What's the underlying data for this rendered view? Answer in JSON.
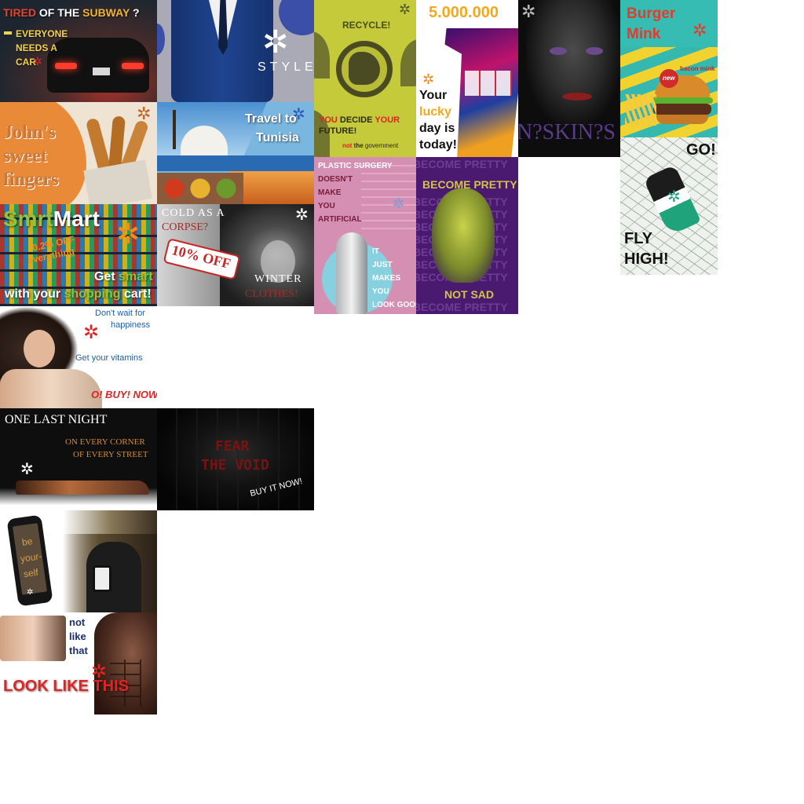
{
  "colors": {
    "accent_red": "#e02424",
    "accent_orange": "#f28c1a",
    "lime": "#c3c936",
    "pink": "#d58cb0",
    "purple": "#4a1a70"
  },
  "ads": {
    "subway": {
      "l1a": "TIRED",
      "l1b": "OF THE",
      "l1c": "SUBWAY",
      "l1d": "?",
      "l2": "EVERYONE",
      "l3": "NEEDS A",
      "l4": "CAR"
    },
    "style": {
      "brand": "STYLE."
    },
    "recycle": {
      "title": "RECYCLE!",
      "you": "YOU",
      "decide": "DECIDE",
      "your": "YOUR",
      "future": "FUTURE!",
      "not": "not",
      "the": "the",
      "gov": "government"
    },
    "lottery": {
      "amount": "5.000.000",
      "your": "Your",
      "lucky": "lucky",
      "day": "day is",
      "today": "today!"
    },
    "skin": {
      "text": "N?SKIN?S"
    },
    "burger": {
      "l1": "Burger",
      "l2": "Mink",
      "badge": "new",
      "sub": "bacon mink"
    },
    "johns": {
      "l1": "John's",
      "l2": "sweet",
      "l3": "fingers"
    },
    "tunisia": {
      "l1": "Travel to",
      "l2": "Tunisia"
    },
    "plastic": {
      "l1": "PLASTIC SURGERY",
      "l2": "DOESN'T",
      "l3": "MAKE",
      "l4": "YOU",
      "l5": "ARTIFICIAL",
      "l6": "IT",
      "l7": "JUST",
      "l8": "MAKES",
      "l9": "YOU",
      "l10": "LOOK GOOD"
    },
    "pretty": {
      "bg": "BECOME PRETTY",
      "title": "BECOME PRETTY",
      "bottom": "NOT SAD"
    },
    "shoe": {
      "go": "GO!",
      "l1": "FLY",
      "l2": "HIGH!"
    },
    "smrt": {
      "a": "Smrt",
      "b": "Mart",
      "promo1": "0.2% OFF",
      "promo2": "everything",
      "l1a": "Get",
      "l1b": "smart",
      "l2a": "with your",
      "l2b": "shopping",
      "l2c": "cart!"
    },
    "corpse": {
      "l1": "COLD AS A",
      "l2": "CORPSE?",
      "badge": "10% OFF",
      "l3": "WINTER",
      "l4": "CLOTHES!"
    },
    "vitamin": {
      "l1": "Don't wait for",
      "l2": "happiness",
      "l3": "Get your vitamins",
      "l4": "O! BUY! NOW!"
    },
    "lastnight": {
      "l1": "ONE LAST NIGHT",
      "l2": "ON EVERY CORNER",
      "l3": "OF EVERY STREET"
    },
    "void": {
      "l1": "FEAR",
      "l2": "THE VOID",
      "l3": "BUY IT NOW!"
    },
    "phone": {
      "l1": "be",
      "l2": "your-",
      "l3": "self"
    },
    "fitness": {
      "l1": "not",
      "l2": "like",
      "l3": "that",
      "l4": "LOOK LIKE THIS"
    }
  }
}
